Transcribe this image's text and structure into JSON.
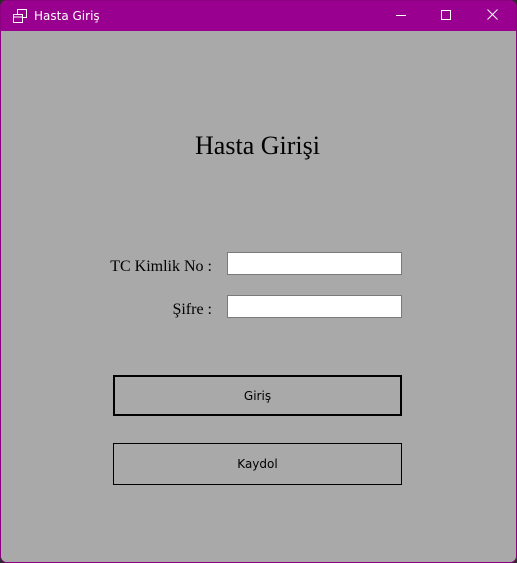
{
  "window": {
    "title": "Hasta Giriş",
    "titlebar_color": "#990090",
    "background_color": "#a9a9a9",
    "controls": {
      "minimize_icon": "minimize-icon",
      "maximize_icon": "maximize-icon",
      "close_icon": "close-icon"
    }
  },
  "form": {
    "heading": "Hasta Girişi",
    "tc_label": "TC Kimlik No :",
    "tc_value": "",
    "password_label": "Şifre :",
    "password_value": "",
    "login_button": "Giriş",
    "register_button": "Kaydol"
  }
}
